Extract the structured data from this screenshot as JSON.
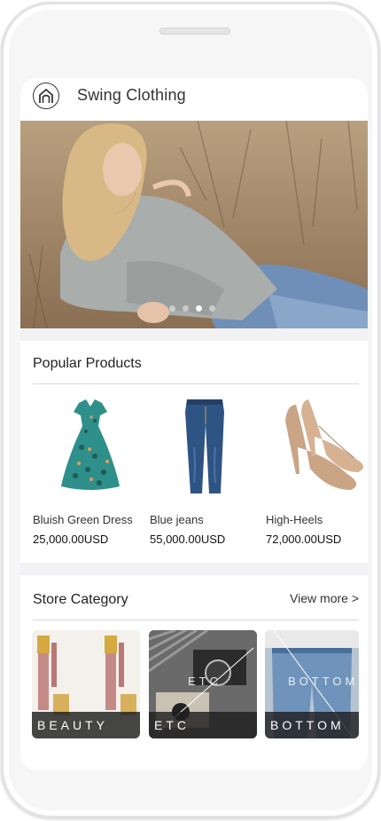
{
  "app": {
    "title": "Swing Clothing",
    "logo_icon": "house-logo-icon"
  },
  "hero": {
    "slide_count": 4,
    "active_slide": 3
  },
  "popular": {
    "title": "Popular Products",
    "products": [
      {
        "name": "Bluish Green Dress",
        "price": "25,000.00USD",
        "icon": "dress-image"
      },
      {
        "name": "Blue jeans",
        "price": "55,000.00USD",
        "icon": "jeans-image"
      },
      {
        "name": "High-Heels",
        "price": "72,000.00USD",
        "icon": "heels-image"
      }
    ]
  },
  "category": {
    "title": "Store Category",
    "view_more": "View more >",
    "tiles": [
      {
        "label": "BEAUTY"
      },
      {
        "label": "ETC",
        "overlay": "ETC"
      },
      {
        "label": "BOTTOM",
        "overlay": "BOTTOM"
      }
    ]
  }
}
